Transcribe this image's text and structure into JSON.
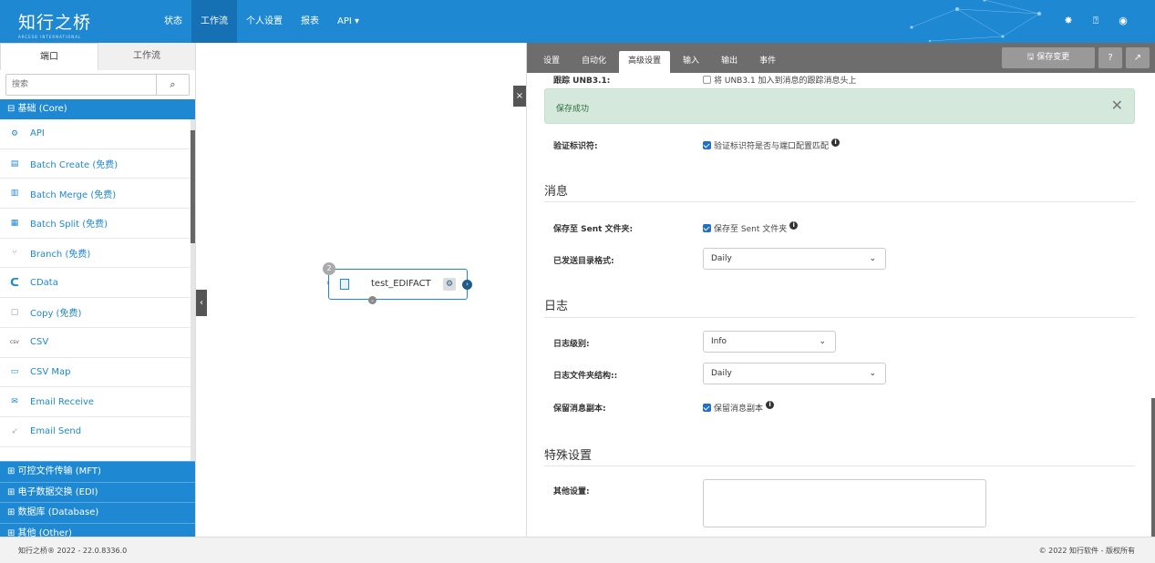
{
  "header": {
    "logo_cn": "知行之桥",
    "logo_en": "ARCESB INTERNATIONAL",
    "nav": [
      "状态",
      "工作流",
      "个人设置",
      "报表",
      "API ▾"
    ]
  },
  "left": {
    "tabs": [
      "端口",
      "工作流"
    ],
    "search_placeholder": "搜索",
    "core_header": "⊟ 基础 (Core)",
    "items": [
      {
        "label": "API",
        "icon": "api-icon"
      },
      {
        "label": "Batch Create (免费)",
        "icon": "batch-create-icon"
      },
      {
        "label": "Batch Merge (免费)",
        "icon": "batch-merge-icon"
      },
      {
        "label": "Batch Split (免费)",
        "icon": "batch-split-icon"
      },
      {
        "label": "Branch (免费)",
        "icon": "branch-icon"
      },
      {
        "label": "CData",
        "icon": "cdata-icon"
      },
      {
        "label": "Copy (免费)",
        "icon": "copy-icon"
      },
      {
        "label": "CSV",
        "icon": "csv-icon"
      },
      {
        "label": "CSV Map",
        "icon": "csv-map-icon"
      },
      {
        "label": "Email Receive",
        "icon": "email-receive-icon"
      },
      {
        "label": "Email Send",
        "icon": "email-send-icon"
      }
    ],
    "categories": [
      "⊞ 可控文件传输 (MFT)",
      "⊞ 电子数据交换 (EDI)",
      "⊞ 数据库 (Database)",
      "⊞ 其他 (Other)"
    ]
  },
  "canvas": {
    "node_name": "test_EDIFACT",
    "node_badge": "2"
  },
  "right": {
    "tabs": [
      "设置",
      "自动化",
      "高级设置",
      "输入",
      "输出",
      "事件"
    ],
    "active_tab": "高级设置",
    "save_label": "🖫 保存变更",
    "track_label": "跟踪 UNB3.1:",
    "track_check": "将 UNB3.1 加入到消息的跟踪消息头上",
    "success_msg": "保存成功",
    "validate_label": "验证标识符:",
    "validate_check": "验证标识符是否与端口配置匹配",
    "sec_message": "消息",
    "save_sent_label": "保存至 Sent 文件夹:",
    "save_sent_check": "保存至 Sent 文件夹",
    "sent_format_label": "已发送目录格式:",
    "sent_format_value": "Daily",
    "sec_log": "日志",
    "log_level_label": "日志级别:",
    "log_level_value": "Info",
    "log_folder_label": "日志文件夹结构::",
    "log_folder_value": "Daily",
    "keep_copy_label": "保留消息副本:",
    "keep_copy_check": "保留消息副本",
    "sec_special": "特殊设置",
    "other_label": "其他设置:"
  },
  "footer": {
    "left": "知行之桥® 2022 - 22.0.8336.0",
    "right": "© 2022 知行软件 - 版权所有"
  }
}
